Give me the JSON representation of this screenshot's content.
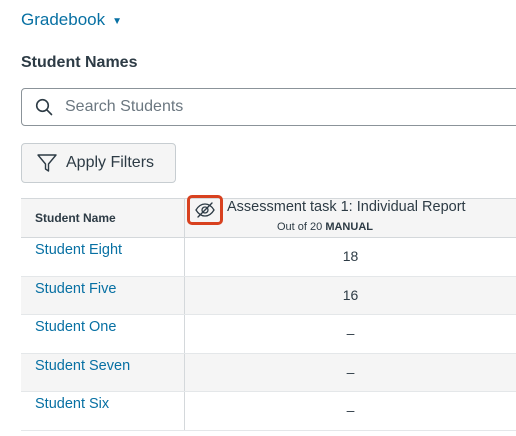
{
  "header": {
    "gradebook_label": "Gradebook",
    "caret": "▼"
  },
  "section_title": "Student Names",
  "search": {
    "placeholder": "Search Students",
    "value": ""
  },
  "filters": {
    "apply_label": "Apply Filters"
  },
  "grid": {
    "name_header": "Student Name",
    "assignment": {
      "title": "Assessment task 1: Individual Report",
      "out_of": "Out of 20",
      "mode": "MANUAL",
      "hidden_icon": "eye-off-icon"
    },
    "rows": [
      {
        "name": "Student Eight",
        "score": "18"
      },
      {
        "name": "Student Five",
        "score": "16"
      },
      {
        "name": "Student One",
        "score": "–"
      },
      {
        "name": "Student Seven",
        "score": "–"
      },
      {
        "name": "Student Six",
        "score": "–"
      }
    ]
  },
  "colors": {
    "link": "#0770a3",
    "highlight": "#d8411f",
    "header_bg": "#f5f5f5"
  }
}
